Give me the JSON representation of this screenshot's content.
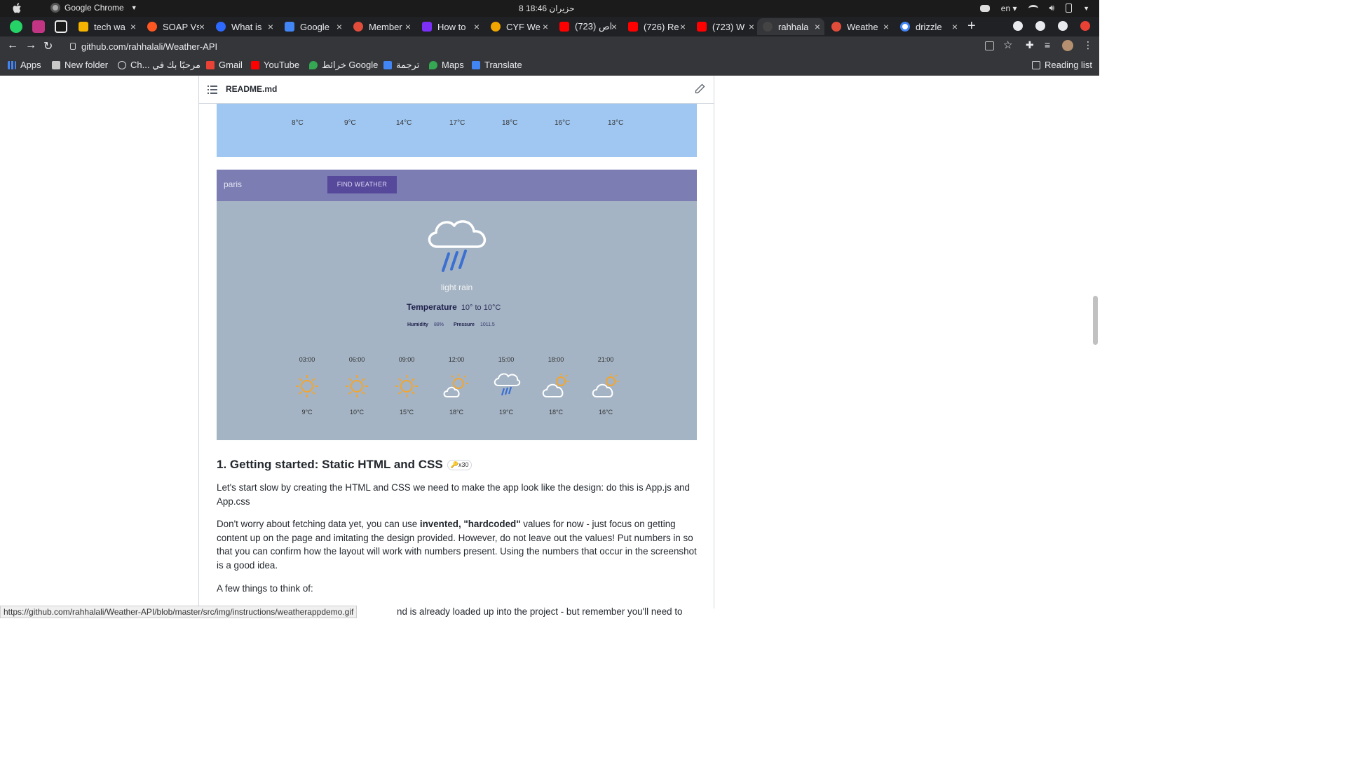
{
  "os": {
    "app_name": "Google Chrome",
    "clock": "8 حزيران 18:46",
    "lang": "en"
  },
  "tabs": [
    {
      "title": "tech wa"
    },
    {
      "title": "SOAP Vs"
    },
    {
      "title": "What is"
    },
    {
      "title": "Google"
    },
    {
      "title": "Member"
    },
    {
      "title": "How to"
    },
    {
      "title": "CYF We"
    },
    {
      "title": "(723) اص"
    },
    {
      "title": "(726) Re"
    },
    {
      "title": "(723) W"
    },
    {
      "title": "rahhala"
    },
    {
      "title": "Weathe"
    },
    {
      "title": "drizzle"
    }
  ],
  "address": {
    "url": "github.com/rahhalali/Weather-API"
  },
  "bookmarks": {
    "apps": "Apps",
    "new_folder": "New folder",
    "arabic_hello": "Ch... مرحبًا بك في",
    "gmail": "Gmail",
    "youtube": "YouTube",
    "maps_ar": "خرائط Google",
    "translate_ar": "ترجمة",
    "maps": "Maps",
    "translate": "Translate",
    "reading_list": "Reading list"
  },
  "readme": {
    "file_name": "README.md"
  },
  "top_temps": [
    "8°C",
    "9°C",
    "14°C",
    "17°C",
    "18°C",
    "16°C",
    "13°C"
  ],
  "weather_demo": {
    "city": "paris",
    "find_button": "FIND WEATHER",
    "description": "light rain",
    "temperature_label": "Temperature",
    "temperature_range": "10° to 10°C",
    "humidity_label": "Humidity",
    "humidity_value": "88%",
    "pressure_label": "Pressure",
    "pressure_value": "1011.5",
    "hours": [
      {
        "time": "03:00",
        "temp": "9°C",
        "icon": "sun-icon"
      },
      {
        "time": "06:00",
        "temp": "10°C",
        "icon": "sun-icon"
      },
      {
        "time": "09:00",
        "temp": "15°C",
        "icon": "sun-icon"
      },
      {
        "time": "12:00",
        "temp": "18°C",
        "icon": "sun-cloud-icon"
      },
      {
        "time": "15:00",
        "temp": "19°C",
        "icon": "rain-cloud-icon"
      },
      {
        "time": "18:00",
        "temp": "18°C",
        "icon": "cloud-sun-icon"
      },
      {
        "time": "21:00",
        "temp": "16°C",
        "icon": "cloud-sun-icon"
      }
    ]
  },
  "content": {
    "heading": "1. Getting started: Static HTML and CSS",
    "badge": "🔑x30",
    "p1": "Let's start slow by creating the HTML and CSS we need to make the app look like the design: do this is App.js and App.css",
    "p2_a": "Don't worry about fetching data yet, you can use ",
    "p2_b": "invented, \"hardcoded\"",
    "p2_c": " values for now - just focus on getting content up on the page and imitating the design provided. However, do not leave out the values! Put numbers in so that you can confirm how the layout will work with numbers present. Using the numbers that occur in the screenshot is a good idea.",
    "p3": "A few things to think of:",
    "p4_tail": "nd is already loaded up into the project - but remember you'll need to"
  },
  "status_url": "https://github.com/rahhalali/Weather-API/blob/master/src/img/instructions/weatherappdemo.gif",
  "colors": {
    "chrome_dark": "#202124",
    "chrome_toolbar": "#35363a",
    "weather_bar": "#7b7db3",
    "weather_bg": "#a4b4c4",
    "find_button": "#56489a",
    "blue_panel": "#a0c7f1"
  }
}
